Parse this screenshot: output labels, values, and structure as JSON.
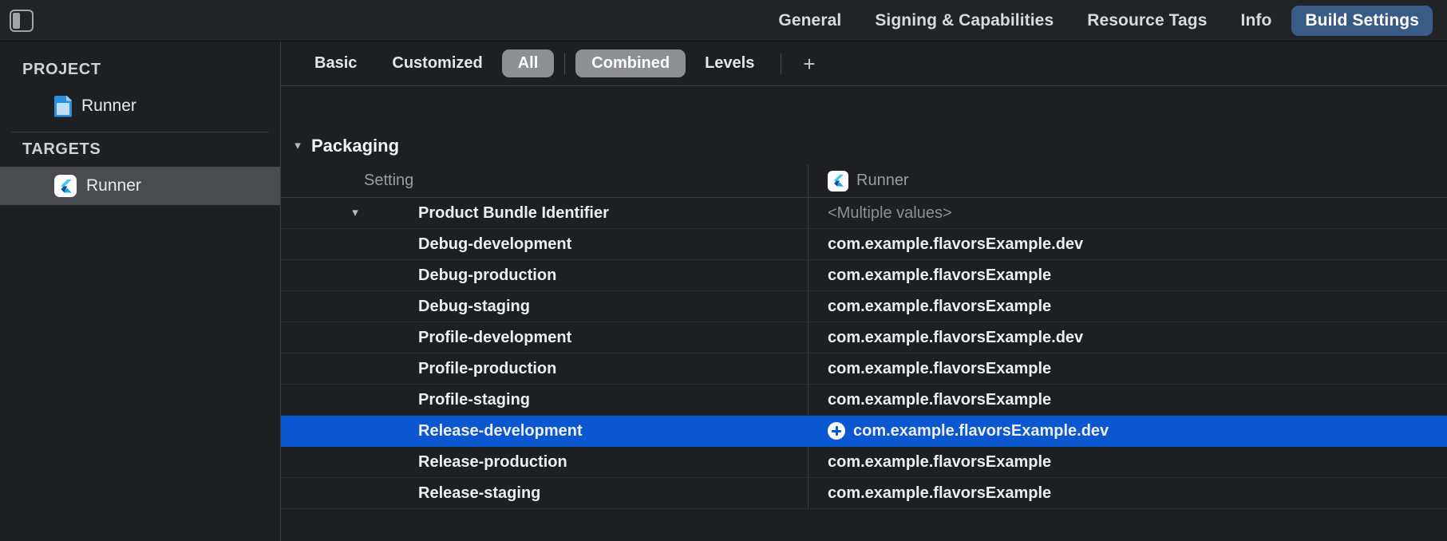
{
  "window": {
    "sidebar_toggle_icon": "sidebar-left-panel-icon"
  },
  "topbar": {
    "tabs": [
      {
        "label": "General",
        "selected": false
      },
      {
        "label": "Signing & Capabilities",
        "selected": false
      },
      {
        "label": "Resource Tags",
        "selected": false
      },
      {
        "label": "Info",
        "selected": false
      },
      {
        "label": "Build Settings",
        "selected": true
      }
    ],
    "selected_tab_bg": "#3a5b85"
  },
  "sidebar": {
    "sections": [
      {
        "label": "PROJECT",
        "items": [
          {
            "label": "Runner",
            "icon": "document-icon",
            "selected": false
          }
        ]
      },
      {
        "label": "TARGETS",
        "items": [
          {
            "label": "Runner",
            "icon": "flutter-logo-icon",
            "selected": true
          }
        ]
      }
    ]
  },
  "filterbar": {
    "items": [
      {
        "label": "Basic",
        "active": false
      },
      {
        "label": "Customized",
        "active": false
      },
      {
        "label": "All",
        "active": true
      },
      {
        "label": "Combined",
        "active": true
      },
      {
        "label": "Levels",
        "active": false
      }
    ],
    "add_button_label": "+",
    "active_pill_bg": "#8e8f93"
  },
  "table": {
    "section": {
      "title": "Packaging",
      "expanded_icon": "chevron-down-icon"
    },
    "columns": {
      "setting_header": "Setting",
      "target_header": "Runner",
      "target_icon": "flutter-logo-icon"
    },
    "parent_row": {
      "name": "Product Bundle Identifier",
      "value": "<Multiple values>",
      "expanded_icon": "chevron-down-icon"
    },
    "rows": [
      {
        "name": "Debug-development",
        "value": "com.example.flavorsExample.dev",
        "selected": false,
        "has_add_button": false
      },
      {
        "name": "Debug-production",
        "value": "com.example.flavorsExample",
        "selected": false,
        "has_add_button": false
      },
      {
        "name": "Debug-staging",
        "value": "com.example.flavorsExample",
        "selected": false,
        "has_add_button": false
      },
      {
        "name": "Profile-development",
        "value": "com.example.flavorsExample.dev",
        "selected": false,
        "has_add_button": false
      },
      {
        "name": "Profile-production",
        "value": "com.example.flavorsExample",
        "selected": false,
        "has_add_button": false
      },
      {
        "name": "Profile-staging",
        "value": "com.example.flavorsExample",
        "selected": false,
        "has_add_button": false
      },
      {
        "name": "Release-development",
        "value": "com.example.flavorsExample.dev",
        "selected": true,
        "has_add_button": true
      },
      {
        "name": "Release-production",
        "value": "com.example.flavorsExample",
        "selected": false,
        "has_add_button": false
      },
      {
        "name": "Release-staging",
        "value": "com.example.flavorsExample",
        "selected": false,
        "has_add_button": false
      }
    ],
    "selection_color": "#0b57d0"
  }
}
